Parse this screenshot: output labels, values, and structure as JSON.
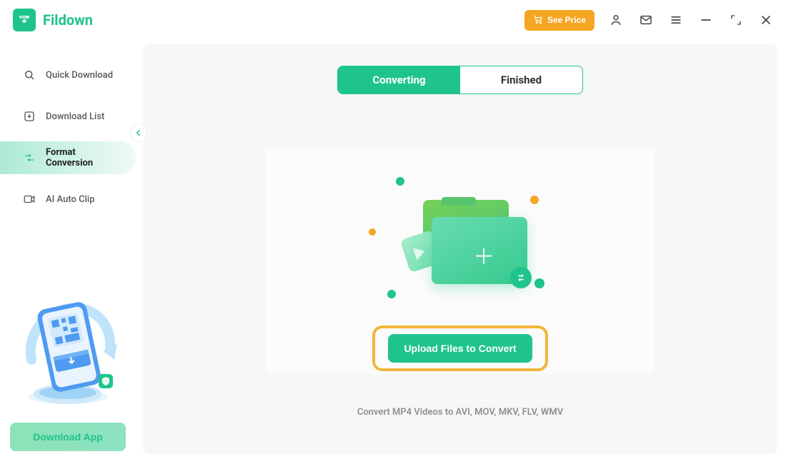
{
  "brand": {
    "name": "Fildown"
  },
  "header": {
    "price_button_label": "See Price"
  },
  "sidebar": {
    "items": [
      {
        "label": "Quick Download"
      },
      {
        "label": "Download List"
      },
      {
        "label": "Format Conversion"
      },
      {
        "label": "AI Auto Clip"
      }
    ],
    "download_app_label": "Download App"
  },
  "main": {
    "tabs": {
      "converting": "Converting",
      "finished": "Finished"
    },
    "upload_button_label": "Upload Files to Convert",
    "footer_hint": "Convert MP4 Videos to AVI, MOV, MKV, FLV, WMV"
  }
}
